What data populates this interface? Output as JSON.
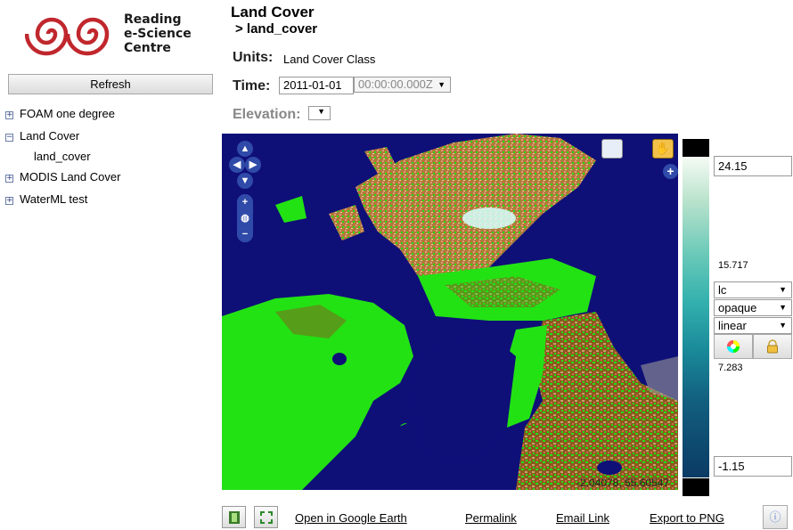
{
  "logo": {
    "line1": "Reading",
    "line2": "e-Science",
    "line3": "Centre"
  },
  "sidebar": {
    "refresh_label": "Refresh",
    "items": [
      {
        "label": "FOAM one degree",
        "toggle": "+"
      },
      {
        "label": "Land Cover",
        "toggle": "−",
        "children": [
          "land_cover"
        ]
      },
      {
        "label": "MODIS Land Cover",
        "toggle": "+"
      },
      {
        "label": "WaterML test",
        "toggle": "+"
      }
    ]
  },
  "header": {
    "title": "Land Cover",
    "subtitle": "> land_cover",
    "units_label": "Units:",
    "units_value": "Land Cover Class",
    "time_label": "Time:",
    "date_value": "2011-01-01",
    "time_value": "00:00:00.000Z",
    "elevation_label": "Elevation:"
  },
  "map": {
    "coords": "-2.04078, 55.60547",
    "colors": {
      "water": "#0f0f78",
      "grass": "#22e214",
      "crop": "#8a5a1e",
      "heath": "#c8a06a",
      "snow": "#d8ffff",
      "urban": "#9a9a9a"
    }
  },
  "colorbar": {
    "max": "24.15",
    "mid_high": "15.717",
    "mid_low": "7.283",
    "min": "-1.15",
    "palette": "lc",
    "opacity": "opaque",
    "scale": "linear"
  },
  "footer": {
    "google_earth": "Open in Google Earth",
    "permalink": "Permalink",
    "email": "Email Link",
    "export": "Export to PNG"
  }
}
